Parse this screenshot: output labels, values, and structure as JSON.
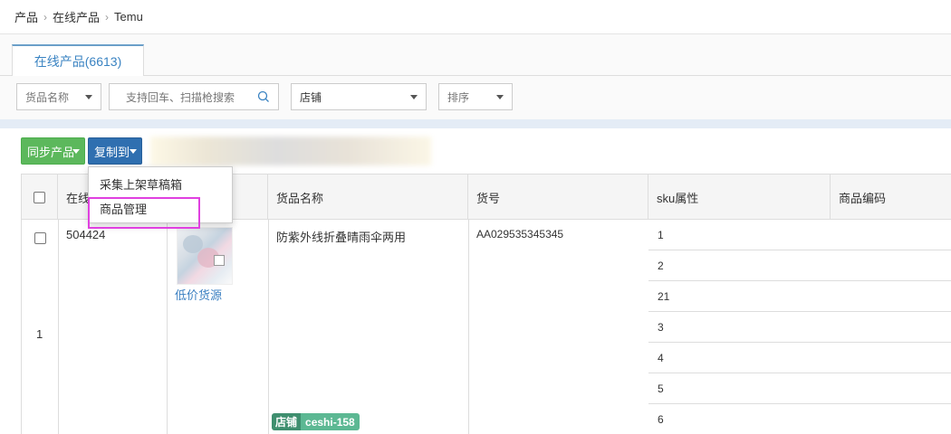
{
  "breadcrumb": [
    "产品",
    "在线产品",
    "Temu"
  ],
  "breadcrumb_sep": "›",
  "tab": {
    "label": "在线产品(6613)"
  },
  "filters": {
    "product_name": "货品名称",
    "search_placeholder": "支持回车、扫描枪搜索",
    "store": "店铺",
    "sort": "排序"
  },
  "toolbar": {
    "sync_label": "同步产品",
    "copy_label": "复制到"
  },
  "dropdown": {
    "items": [
      "采集上架草稿箱",
      "商品管理"
    ]
  },
  "table": {
    "headers": [
      "在线",
      "",
      "货品名称",
      "货号",
      "sku属性",
      "商品编码"
    ],
    "row": {
      "index": "1",
      "online_id": "504424",
      "image_link": "低价货源",
      "name": "防紫外线折叠晴雨伞两用",
      "sku_no": "AA029535345345",
      "tag_label": "店铺",
      "tag_value": "ceshi-158",
      "skus": [
        "1",
        "2",
        "21",
        "3",
        "4",
        "5",
        "6"
      ]
    }
  },
  "colors": {
    "accent": "#3a83c2",
    "sync": "#5cb85c",
    "copy": "#2f6fb0",
    "highlight": "#e040e0"
  }
}
